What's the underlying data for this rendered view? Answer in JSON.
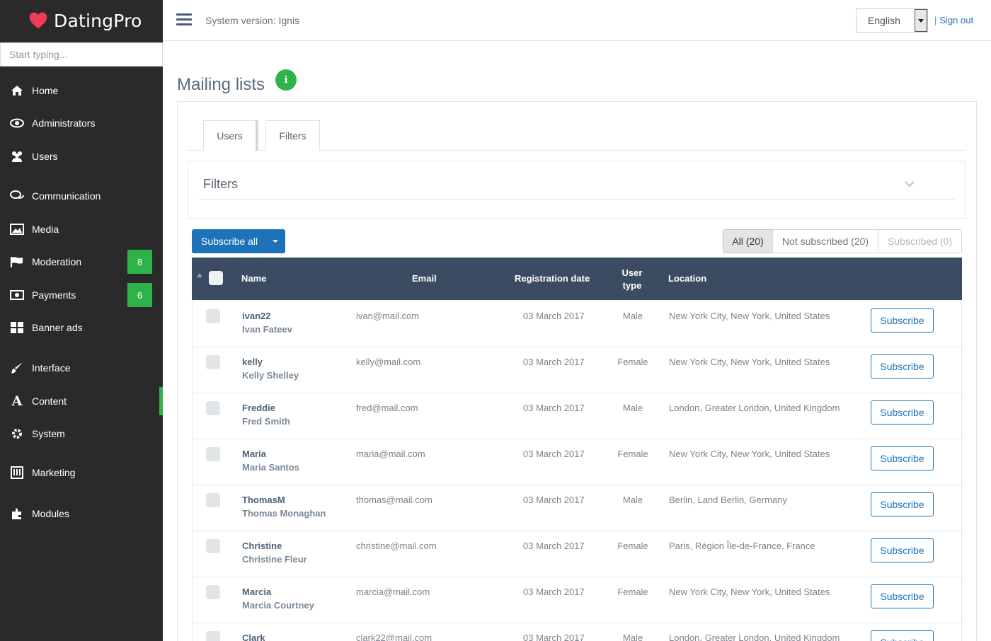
{
  "brand": {
    "name": "DatingPro"
  },
  "sidebar": {
    "search_placeholder": "Start typing...",
    "items": [
      {
        "label": "Home",
        "icon": "home-icon"
      },
      {
        "label": "Administrators",
        "icon": "eye-icon"
      },
      {
        "label": "Users",
        "icon": "users-icon"
      },
      {
        "label": "Communication",
        "icon": "comments-icon"
      },
      {
        "label": "Media",
        "icon": "image-icon"
      },
      {
        "label": "Moderation",
        "icon": "flag-icon",
        "badge": "8"
      },
      {
        "label": "Payments",
        "icon": "money-icon",
        "badge": "6"
      },
      {
        "label": "Banner ads",
        "icon": "grid-icon"
      },
      {
        "label": "Interface",
        "icon": "brush-icon"
      },
      {
        "label": "Content",
        "icon": "font-icon",
        "active": true
      },
      {
        "label": "System",
        "icon": "gear-icon"
      },
      {
        "label": "Marketing",
        "icon": "chart-icon"
      },
      {
        "label": "Modules",
        "icon": "puzzle-icon"
      }
    ]
  },
  "topbar": {
    "system_version": "System version: Ignis",
    "language": "English",
    "signout_sep": "|",
    "signout": "Sign out"
  },
  "page": {
    "title": "Mailing lists",
    "info_icon": "i",
    "tabs": [
      {
        "label": "Users"
      },
      {
        "label": "Filters"
      }
    ],
    "filters_title": "Filters",
    "subscribe_all": "Subscribe all",
    "filter_buttons": [
      {
        "label": "All (20)",
        "active": true
      },
      {
        "label": "Not subscribed (20)"
      },
      {
        "label": "Subscribed (0)",
        "disabled": true
      }
    ]
  },
  "table": {
    "headers": {
      "name": "Name",
      "email": "Email",
      "registration_date": "Registration date",
      "user_type_1": "User",
      "user_type_2": "type",
      "location": "Location"
    },
    "action_label": "Subscribe",
    "rows": [
      {
        "username": "ivan22",
        "fullname": "Ivan Fateev",
        "email": "ivan@mail.com",
        "date": "03 March 2017",
        "type": "Male",
        "location": "New York City, New York, United States"
      },
      {
        "username": "kelly",
        "fullname": "Kelly Shelley",
        "email": "kelly@mail.com",
        "date": "03 March 2017",
        "type": "Female",
        "location": "New York City, New York, United States"
      },
      {
        "username": "Freddie",
        "fullname": "Fred Smith",
        "email": "fred@mail.com",
        "date": "03 March 2017",
        "type": "Male",
        "location": "London, Greater London, United Kingdom"
      },
      {
        "username": "Maria",
        "fullname": "Maria Santos",
        "email": "maria@mail.com",
        "date": "03 March 2017",
        "type": "Female",
        "location": "New York City, New York, United States"
      },
      {
        "username": "ThomasM",
        "fullname": "Thomas Monaghan",
        "email": "thomas@mail.com",
        "date": "03 March 2017",
        "type": "Male",
        "location": "Berlin, Land Berlin, Germany"
      },
      {
        "username": "Christine",
        "fullname": "Christine Fleur",
        "email": "christine@mail.com",
        "date": "03 March 2017",
        "type": "Female",
        "location": "Paris, Région Île-de-France, France"
      },
      {
        "username": "Marcia",
        "fullname": "Marcia Courtney",
        "email": "marcia@mail.com",
        "date": "03 March 2017",
        "type": "Female",
        "location": "New York City, New York, United States"
      },
      {
        "username": "Clark",
        "fullname": "",
        "email": "clark22@mail.com",
        "date": "03 March 2017",
        "type": "Male",
        "location": "London, Greater London, United Kingdom"
      }
    ]
  },
  "colors": {
    "sidebar_bg": "#2a2a2a",
    "accent_green": "#2fb349",
    "primary_blue": "#1e73b8",
    "table_header": "#3b4c62"
  }
}
